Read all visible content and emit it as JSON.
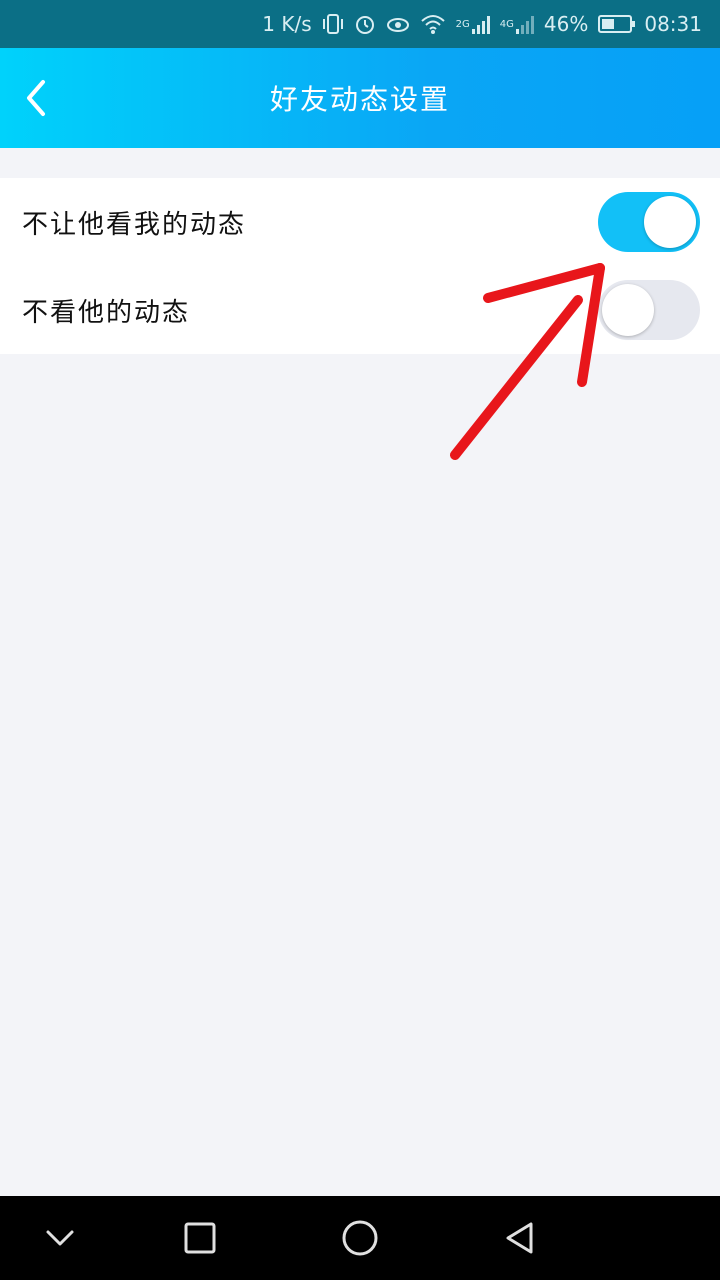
{
  "status_bar": {
    "network_speed": "1 K/s",
    "sim1_type": "2G",
    "sim2_type": "4G",
    "battery_percent": "46%",
    "time": "08:31",
    "icons": [
      "vibrate-icon",
      "alarm-icon",
      "eye-icon",
      "wifi-icon",
      "signal-icon",
      "battery-icon"
    ]
  },
  "header": {
    "title": "好友动态设置",
    "back_icon": "chevron-left-icon"
  },
  "settings": [
    {
      "label": "不让他看我的动态",
      "enabled": true
    },
    {
      "label": "不看他的动态",
      "enabled": false
    }
  ],
  "colors": {
    "header_start": "#00d2fb",
    "header_end": "#06a0f7",
    "toggle_on": "#12c0f7",
    "toggle_off": "#e6e8ef",
    "annotation": "#e8161b"
  },
  "system_nav": {
    "icons": [
      "chevron-down-icon",
      "square-icon",
      "circle-icon",
      "triangle-back-icon"
    ]
  }
}
